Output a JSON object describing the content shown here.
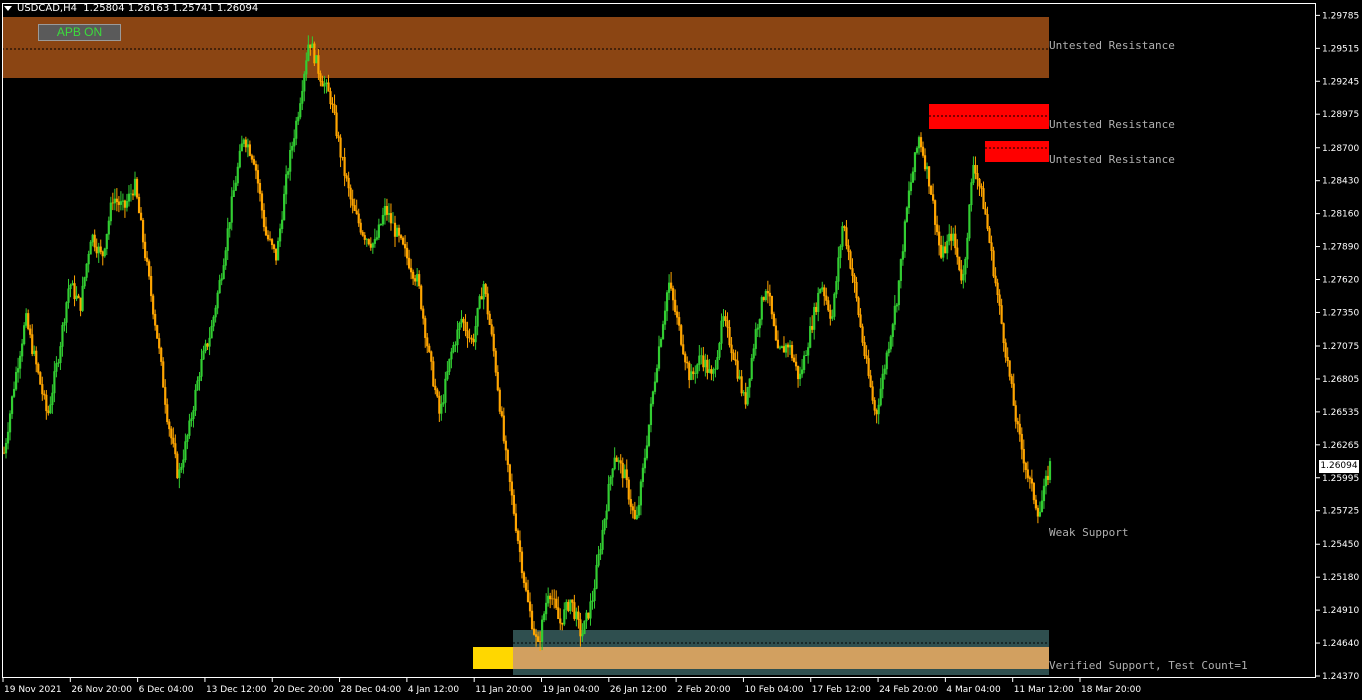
{
  "header": {
    "symbol_label": "USDCAD,H4  1.25804 1.26163 1.25741 1.26094"
  },
  "controls": {
    "apb_button_label": "APB ON"
  },
  "colors": {
    "background": "#000000",
    "bull": "#32cd32",
    "bear": "#ffa500",
    "axis": "#ffffff",
    "zone_brown": "#8b4513",
    "zone_red": "#ff0000",
    "zone_teal": "#2f4f4f",
    "zone_tan": "#d2a060",
    "zone_yellow": "#ffd700"
  },
  "chart_data": {
    "type": "candlestick",
    "symbol": "USDCAD",
    "timeframe": "H4",
    "ohlc": {
      "open": 1.25804,
      "high": 1.26163,
      "low": 1.25741,
      "close": 1.26094
    },
    "last_price": 1.26094,
    "ylim": [
      1.2437,
      1.2978
    ],
    "yticks": [
      "1.29785",
      "1.29515",
      "1.29245",
      "1.28975",
      "1.28700",
      "1.28430",
      "1.28160",
      "1.27890",
      "1.27620",
      "1.27350",
      "1.27075",
      "1.26805",
      "1.26535",
      "1.26265",
      "1.25995",
      "1.25725",
      "1.25450",
      "1.25180",
      "1.24910",
      "1.24640",
      "1.24370"
    ],
    "xticks": [
      "19 Nov 2021",
      "26 Nov 20:00",
      "6 Dec 04:00",
      "13 Dec 12:00",
      "20 Dec 20:00",
      "28 Dec 04:00",
      "4 Jan 12:00",
      "11 Jan 20:00",
      "19 Jan 04:00",
      "26 Jan 12:00",
      "2 Feb 20:00",
      "10 Feb 04:00",
      "17 Feb 12:00",
      "24 Feb 20:00",
      "4 Mar 04:00",
      "11 Mar 12:00",
      "18 Mar 20:00"
    ],
    "path_closes": [
      1.262,
      1.268,
      1.273,
      1.269,
      1.265,
      1.27,
      1.276,
      1.274,
      1.28,
      1.278,
      1.283,
      1.282,
      1.284,
      1.278,
      1.272,
      1.265,
      1.26,
      1.264,
      1.269,
      1.272,
      1.277,
      1.283,
      1.288,
      1.286,
      1.28,
      1.278,
      1.285,
      1.29,
      1.296,
      1.293,
      1.291,
      1.286,
      1.282,
      1.28,
      1.279,
      1.282,
      1.28,
      1.278,
      1.276,
      1.27,
      1.265,
      1.27,
      1.273,
      1.271,
      1.276,
      1.27,
      1.262,
      1.256,
      1.25,
      1.246,
      1.251,
      1.248,
      1.25,
      1.247,
      1.25,
      1.256,
      1.262,
      1.26,
      1.256,
      1.263,
      1.27,
      1.276,
      1.272,
      1.268,
      1.27,
      1.268,
      1.273,
      1.27,
      1.266,
      1.272,
      1.276,
      1.27,
      1.271,
      1.268,
      1.272,
      1.276,
      1.273,
      1.281,
      1.276,
      1.27,
      1.265,
      1.27,
      1.275,
      1.283,
      1.288,
      1.284,
      1.278,
      1.28,
      1.276,
      1.286,
      1.282,
      1.276,
      1.27,
      1.264,
      1.26,
      1.257,
      1.261
    ],
    "zones": [
      {
        "kind": "resistance",
        "label": "Untested Resistance",
        "top": 1.2978,
        "bottom": 1.2926,
        "mid": 1.2952,
        "color": "#8b4513",
        "start": "19 Nov 2021"
      },
      {
        "kind": "resistance",
        "label": "Untested Resistance",
        "top": 1.2906,
        "bottom": 1.2884,
        "mid": 1.2895,
        "color": "#ff0000",
        "start": "4 Mar 04:00"
      },
      {
        "kind": "resistance",
        "label": "Untested Resistance",
        "top": 1.2876,
        "bottom": 1.2858,
        "mid": 1.287,
        "color": "#ff0000",
        "start": "11 Mar 12:00"
      },
      {
        "kind": "support",
        "label": "Weak Support",
        "top": null,
        "bottom": null,
        "mid": 1.2555,
        "color": null,
        "start": null
      },
      {
        "kind": "support",
        "label": "Verified Support, Test Count=1",
        "top": 1.2475,
        "bottom": 1.244,
        "mid": 1.2462,
        "color": "#d2a060",
        "start": "19 Jan 04:00"
      }
    ],
    "grid": false,
    "legend": "none"
  }
}
